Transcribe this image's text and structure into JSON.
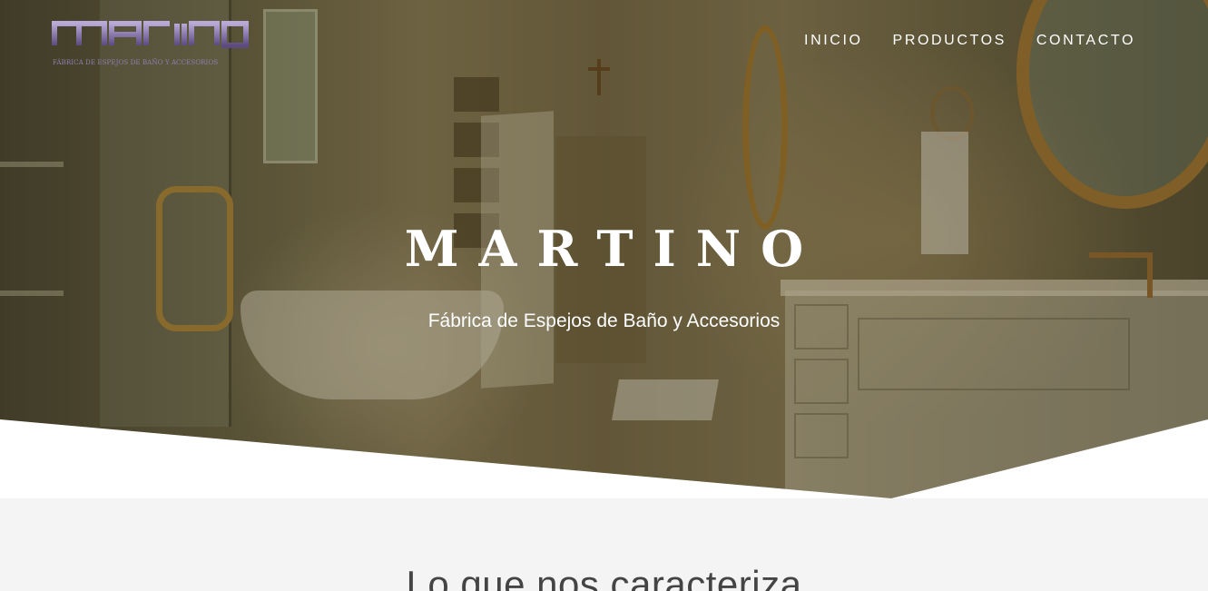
{
  "logo": {
    "wordmark": "martino",
    "tagline": "FÁBRICA DE ESPEJOS DE BAÑO Y ACCESORIOS"
  },
  "nav": {
    "items": [
      {
        "label": "INICIO"
      },
      {
        "label": "PRODUCTOS"
      },
      {
        "label": "CONTACTO"
      }
    ]
  },
  "hero": {
    "title": "MARTINO",
    "subtitle": "Fábrica de Espejos de Baño y Accesorios"
  },
  "features": {
    "heading": "Lo que nos caracteriza"
  },
  "colors": {
    "logo_accent": "#6c5a8e",
    "nav_text": "#ffffff",
    "page_background": "#f4f4f4"
  }
}
